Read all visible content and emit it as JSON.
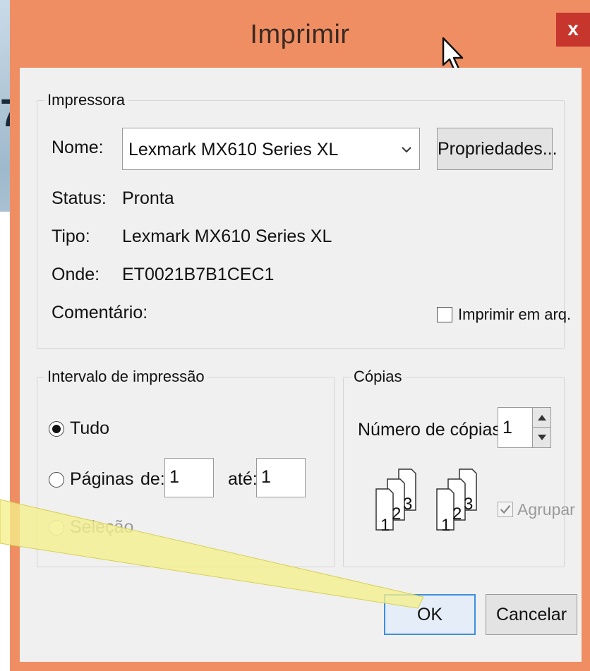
{
  "window": {
    "title": "Imprimir",
    "close": "x"
  },
  "printer": {
    "group_label": "Impressora",
    "name_label": "Nome:",
    "name_value": "Lexmark MX610 Series XL",
    "properties_button": "Propriedades...",
    "status_label": "Status:",
    "status_value": "Pronta",
    "type_label": "Tipo:",
    "type_value": "Lexmark MX610 Series XL",
    "where_label": "Onde:",
    "where_value": "ET0021B7B1CEC1",
    "comment_label": "Comentário:",
    "print_to_file_label": "Imprimir em arq.",
    "print_to_file_checked": false
  },
  "range": {
    "group_label": "Intervalo de impressão",
    "all_label": "Tudo",
    "pages_label": "Páginas",
    "from_label": "de:",
    "from_value": "1",
    "to_label": "até:",
    "to_value": "1",
    "selection_label": "Seleção",
    "selected": "all"
  },
  "copies": {
    "group_label": "Cópias",
    "count_label": "Número de cópias:",
    "count_value": "1",
    "collate_label": "Agrupar",
    "collate_checked": true,
    "page_numbers": [
      "1",
      "2",
      "3"
    ]
  },
  "actions": {
    "ok": "OK",
    "cancel": "Cancelar"
  },
  "colors": {
    "titlebar": "#ef8e63",
    "close_button": "#c7362c",
    "pointer_highlight": "#f3ef8a"
  }
}
